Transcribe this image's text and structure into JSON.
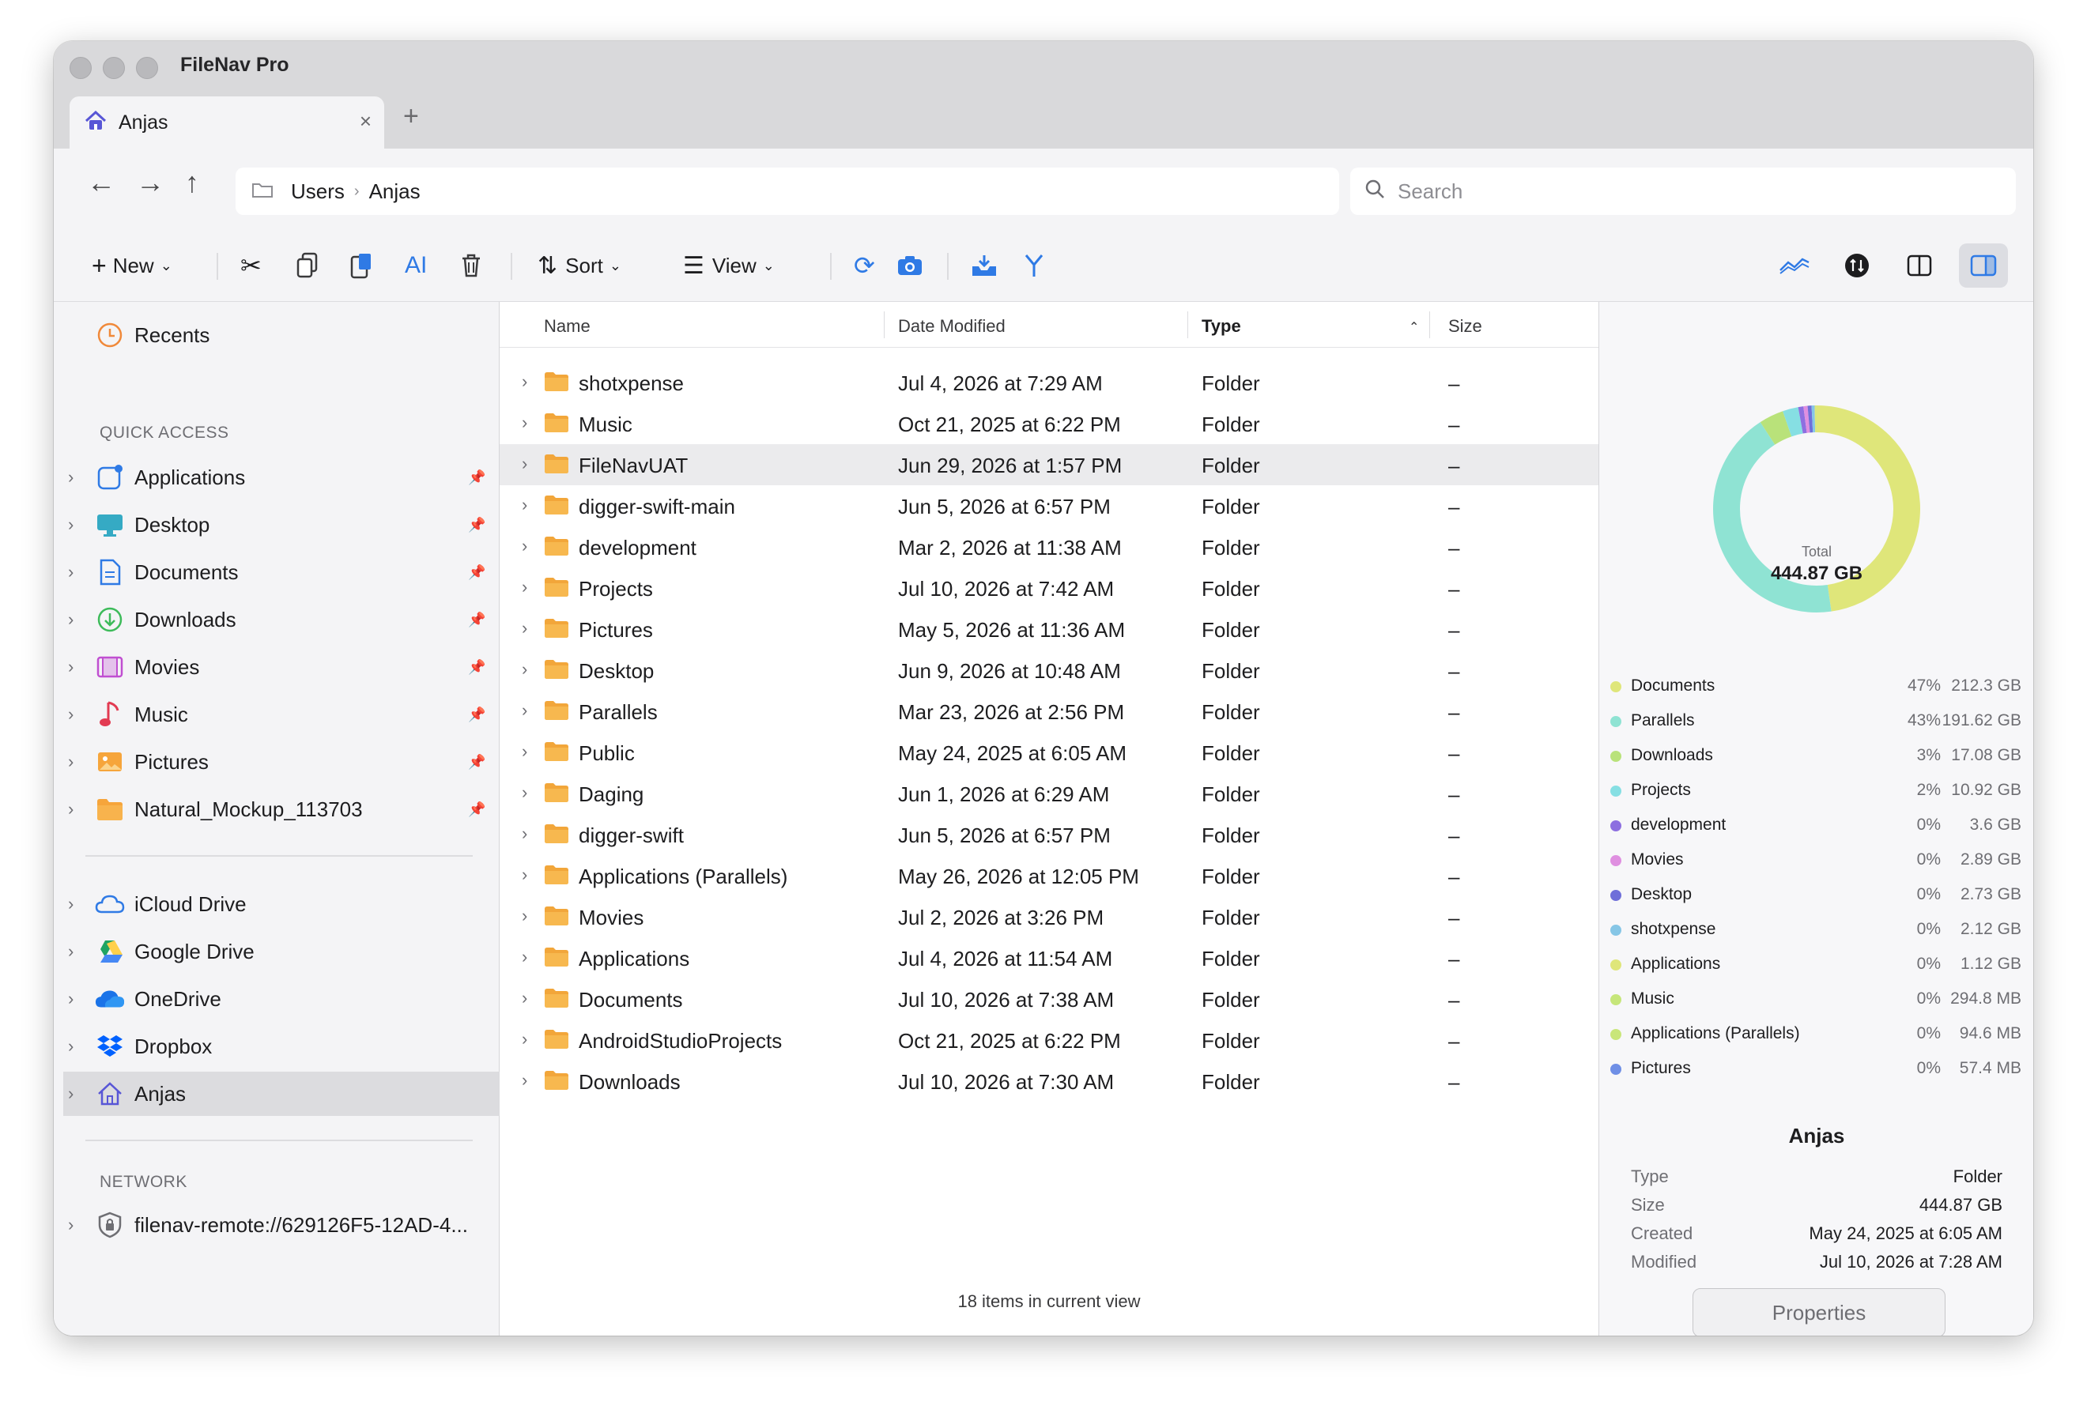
{
  "app": {
    "title": "FileNav Pro"
  },
  "tab": {
    "label": "Anjas",
    "close": "×",
    "new": "+"
  },
  "nav": {
    "back": "←",
    "forward": "→",
    "up": "↑"
  },
  "path": {
    "crumbs": [
      "Users",
      "Anjas"
    ],
    "separator": "›"
  },
  "search": {
    "placeholder": "Search"
  },
  "toolbar": {
    "new_label": "New",
    "sort_label": "Sort",
    "view_label": "View"
  },
  "sidebar": {
    "recents": "Recents",
    "quick_access_header": "QUICK ACCESS",
    "quick_access": [
      {
        "label": "Applications",
        "icon": "applications-icon"
      },
      {
        "label": "Desktop",
        "icon": "desktop-icon"
      },
      {
        "label": "Documents",
        "icon": "document-icon"
      },
      {
        "label": "Downloads",
        "icon": "download-icon"
      },
      {
        "label": "Movies",
        "icon": "film-icon"
      },
      {
        "label": "Music",
        "icon": "music-note-icon"
      },
      {
        "label": "Pictures",
        "icon": "picture-icon"
      },
      {
        "label": "Natural_Mockup_113703",
        "icon": "folder-icon"
      }
    ],
    "cloud": [
      {
        "label": "iCloud Drive",
        "icon": "icloud-icon"
      },
      {
        "label": "Google Drive",
        "icon": "google-drive-icon"
      },
      {
        "label": "OneDrive",
        "icon": "onedrive-icon"
      },
      {
        "label": "Dropbox",
        "icon": "dropbox-icon"
      },
      {
        "label": "Anjas",
        "icon": "home-icon"
      }
    ],
    "network_header": "NETWORK",
    "network": [
      {
        "label": "filenav-remote://629126F5-12AD-4...",
        "icon": "lock-icon"
      }
    ]
  },
  "columns": {
    "name": "Name",
    "date": "Date Modified",
    "type": "Type",
    "size": "Size"
  },
  "files": [
    {
      "name": "shotxpense",
      "date": "Jul 4, 2026 at 7:29 AM",
      "type": "Folder",
      "size": "–"
    },
    {
      "name": "Music",
      "date": "Oct 21, 2025 at 6:22 PM",
      "type": "Folder",
      "size": "–"
    },
    {
      "name": "FileNavUAT",
      "date": "Jun 29, 2026 at 1:57 PM",
      "type": "Folder",
      "size": "–"
    },
    {
      "name": "digger-swift-main",
      "date": "Jun 5, 2026 at 6:57 PM",
      "type": "Folder",
      "size": "–"
    },
    {
      "name": "development",
      "date": "Mar 2, 2026 at 11:38 AM",
      "type": "Folder",
      "size": "–"
    },
    {
      "name": "Projects",
      "date": "Jul 10, 2026 at 7:42 AM",
      "type": "Folder",
      "size": "–"
    },
    {
      "name": "Pictures",
      "date": "May 5, 2026 at 11:36 AM",
      "type": "Folder",
      "size": "–"
    },
    {
      "name": "Desktop",
      "date": "Jun 9, 2026 at 10:48 AM",
      "type": "Folder",
      "size": "–"
    },
    {
      "name": "Parallels",
      "date": "Mar 23, 2026 at 2:56 PM",
      "type": "Folder",
      "size": "–"
    },
    {
      "name": "Public",
      "date": "May 24, 2025 at 6:05 AM",
      "type": "Folder",
      "size": "–"
    },
    {
      "name": "Daging",
      "date": "Jun 1, 2026 at 6:29 AM",
      "type": "Folder",
      "size": "–"
    },
    {
      "name": "digger-swift",
      "date": "Jun 5, 2026 at 6:57 PM",
      "type": "Folder",
      "size": "–"
    },
    {
      "name": "Applications (Parallels)",
      "date": "May 26, 2026 at 12:05 PM",
      "type": "Folder",
      "size": "–"
    },
    {
      "name": "Movies",
      "date": "Jul 2, 2026 at 3:26 PM",
      "type": "Folder",
      "size": "–"
    },
    {
      "name": "Applications",
      "date": "Jul 4, 2026 at 11:54 AM",
      "type": "Folder",
      "size": "–"
    },
    {
      "name": "Documents",
      "date": "Jul 10, 2026 at 7:38 AM",
      "type": "Folder",
      "size": "–"
    },
    {
      "name": "AndroidStudioProjects",
      "date": "Oct 21, 2025 at 6:22 PM",
      "type": "Folder",
      "size": "–"
    },
    {
      "name": "Downloads",
      "date": "Jul 10, 2026 at 7:30 AM",
      "type": "Folder",
      "size": "–"
    }
  ],
  "status": {
    "items": "18 items in current view"
  },
  "usage": {
    "total_label": "Total",
    "total_value": "444.87 GB",
    "entries": [
      {
        "name": "Documents",
        "percent": "47%",
        "size": "212.3 GB",
        "color": "#dfe67a"
      },
      {
        "name": "Parallels",
        "percent": "43%",
        "size": "191.62 GB",
        "color": "#8fe3d3"
      },
      {
        "name": "Downloads",
        "percent": "3%",
        "size": "17.08 GB",
        "color": "#b9e27a"
      },
      {
        "name": "Projects",
        "percent": "2%",
        "size": "10.92 GB",
        "color": "#86dfe3"
      },
      {
        "name": "development",
        "percent": "0%",
        "size": "3.6 GB",
        "color": "#8d6fe0"
      },
      {
        "name": "Movies",
        "percent": "0%",
        "size": "2.89 GB",
        "color": "#df8fe0"
      },
      {
        "name": "Desktop",
        "percent": "0%",
        "size": "2.73 GB",
        "color": "#6f6fd9"
      },
      {
        "name": "shotxpense",
        "percent": "0%",
        "size": "2.12 GB",
        "color": "#86c6e6"
      },
      {
        "name": "Applications",
        "percent": "0%",
        "size": "1.12 GB",
        "color": "#dfe67a"
      },
      {
        "name": "Music",
        "percent": "0%",
        "size": "294.8 MB",
        "color": "#c6e67a"
      },
      {
        "name": "Applications (Parallels)",
        "percent": "0%",
        "size": "94.6 MB",
        "color": "#c9e67a"
      },
      {
        "name": "Pictures",
        "percent": "0%",
        "size": "57.4 MB",
        "color": "#6f8fe6"
      }
    ],
    "slices": [
      47.7,
      43.1,
      3.84,
      2.45,
      0.81,
      0.65,
      0.61,
      0.48,
      0.25,
      0.07,
      0.02,
      0.01
    ]
  },
  "info": {
    "title": "Anjas",
    "rows": [
      {
        "key": "Type",
        "value": "Folder"
      },
      {
        "key": "Size",
        "value": "444.87 GB"
      },
      {
        "key": "Created",
        "value": "May 24, 2025 at 6:05 AM"
      },
      {
        "key": "Modified",
        "value": "Jul 10, 2026 at 7:28 AM"
      }
    ],
    "properties_label": "Properties"
  }
}
